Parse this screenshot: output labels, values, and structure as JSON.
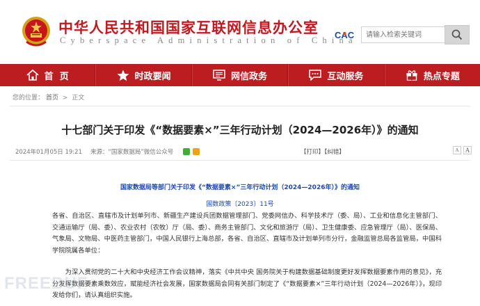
{
  "header": {
    "site_title": "中华人民共和国国家互联网信息办公室",
    "site_subtitle": "Cyberspace Administration of China",
    "logo_text": "CAC",
    "search_placeholder": "请输入检索关键词"
  },
  "nav": {
    "items": [
      {
        "label": "首  页",
        "icon": "home-icon"
      },
      {
        "label": "时政要闻",
        "icon": "star-icon"
      },
      {
        "label": "网信政务",
        "icon": "government-screen-icon"
      },
      {
        "label": "互动服务",
        "icon": "chat-bubble-icon"
      },
      {
        "label": "热点专题",
        "icon": "gift-icon"
      }
    ]
  },
  "breadcrumb": {
    "label": "您的位置：",
    "home": "首页",
    "separator": ">",
    "current": "正文"
  },
  "article": {
    "title": "十七部门关于印发《“数据要素×”三年行动计划（2024—2026年）》的通知",
    "date": "2024年01月05日 19:21",
    "source": "来源：“国家数据局”微信公众号",
    "print": "【打印】",
    "correct": "【纠错】",
    "font_small": "A",
    "font_large": "A",
    "doc_title": "国家数据局等部门关于印发《“数据要素×”三年行动计划（2024—2026年）》的通知",
    "doc_number": "国数政策〔2023〕11号",
    "para1": "各省、自治区、直辖市及计划单列市、新疆生产建设兵团数据管理部门、党委网信办、科学技术厅（委、局）、工业和信息化主管部门、交通运输厅（局、委）、农业农村（农牧）厅（局、委）、商务主管部门、文化和旅游厅（局）、卫生健康委、应急管理厅（局）、医保局、气象局、文物局、中医药主管部门，中国人民银行上海总部，各省、自治区、直辖市及计划单列市分行，金融监管总局各监管局，中国科学院院属各单位：",
    "para2": "为深入贯彻党的二十大和中央经济工作会议精神，落实《中共中央 国务院关于构建数据基础制度更好发挥数据要素作用的意见》，充分发挥数据要素乘数效应，赋能经济社会发展，国家数据局会同有关部门制定了《“数据要素×”三年行动计划（2024—2026年）》，现印发给你们，请认真组织实施。"
  },
  "watermark": {
    "text": "FREEBUF"
  },
  "colors": {
    "brand_red": "#c4171e",
    "nav_red": "#bb1d21",
    "doc_blue": "#1f4aa8"
  }
}
